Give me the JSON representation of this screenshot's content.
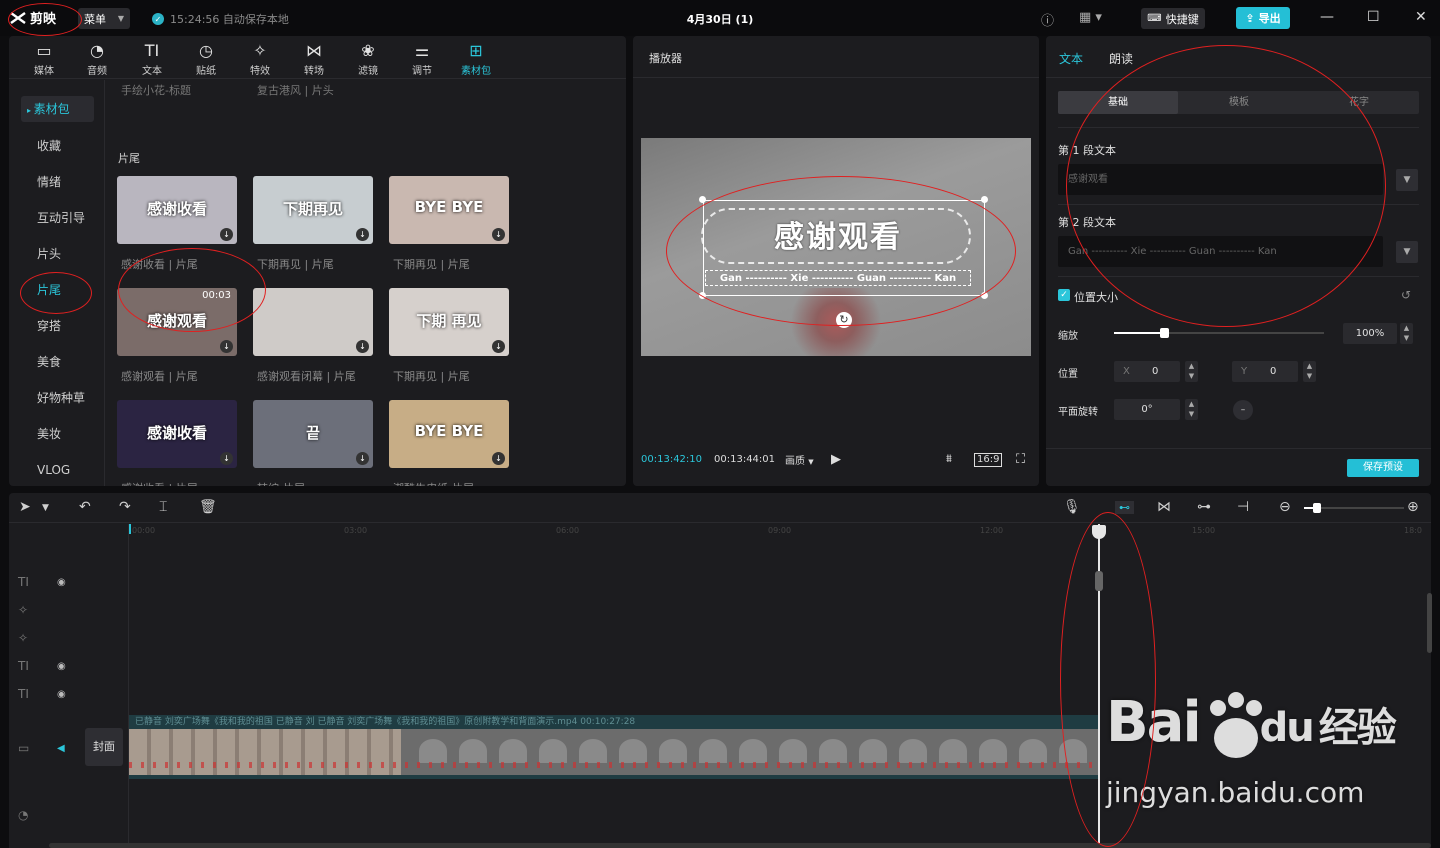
{
  "titlebar": {
    "app_name": "剪映",
    "menu_label": "菜单",
    "save_status": "15:24:56 自动保存本地",
    "doc_title": "4月30日 (1)",
    "shortcut_label": "快捷键",
    "export_label": "导出"
  },
  "media": {
    "toptabs": [
      {
        "icon": "▭",
        "label": "媒体"
      },
      {
        "icon": "◔",
        "label": "音频"
      },
      {
        "icon": "TI",
        "label": "文本"
      },
      {
        "icon": "◷",
        "label": "贴纸"
      },
      {
        "icon": "✧",
        "label": "特效"
      },
      {
        "icon": "⋈",
        "label": "转场"
      },
      {
        "icon": "❀",
        "label": "滤镜"
      },
      {
        "icon": "⚌",
        "label": "调节"
      },
      {
        "icon": "⊞",
        "label": "素材包"
      }
    ],
    "sidenav": [
      "素材包",
      "收藏",
      "情绪",
      "互动引导",
      "片头",
      "片尾",
      "穿搭",
      "美食",
      "好物种草",
      "美妆",
      "VLOG"
    ],
    "prev_labels": [
      "手绘小花-标题",
      "复古港风 | 片头"
    ],
    "section_label": "片尾",
    "items": [
      {
        "caption": "感谢收看 | 片尾",
        "thumb_text": "感谢收看",
        "bg": "#b9b6bf"
      },
      {
        "caption": "下期再见 | 片尾",
        "thumb_text": "下期再见",
        "bg": "#c7cdd0"
      },
      {
        "caption": "下期再见 | 片尾",
        "thumb_text": "BYE BYE",
        "bg": "#c9b8b0"
      },
      {
        "caption": "感谢观看 | 片尾",
        "thumb_text": "感谢观看",
        "bg": "#7b6c69",
        "duration": "00:03"
      },
      {
        "caption": "感谢观看闭幕 | 片尾",
        "thumb_text": "",
        "bg": "#cfcbc8"
      },
      {
        "caption": "下期再见 | 片尾",
        "thumb_text": "下期 再见",
        "bg": "#d6d0cc"
      },
      {
        "caption": "感谢收看 | 片尾",
        "thumb_text": "感谢收看",
        "bg": "#2b2442"
      },
      {
        "caption": "韩综-片尾",
        "thumb_text": "끝",
        "bg": "#6c6f7a"
      },
      {
        "caption": "潮酷牛皮纸-片尾",
        "thumb_text": "BYE BYE",
        "bg": "#c7ad86"
      }
    ]
  },
  "player": {
    "title": "播放器",
    "overlay_title": "感谢观看",
    "overlay_sub": "Gan ---------- Xie ---------- Guan ---------- Kan",
    "current_time": "00:13:42:10",
    "total_time": "00:13:44:01",
    "quality_label": "画质",
    "ratio_label": "16:9"
  },
  "props": {
    "tabs": [
      "文本",
      "朗读"
    ],
    "segments": [
      "基础",
      "模板",
      "花字"
    ],
    "para1_label": "第 1 段文本",
    "para1_value": "感谢观看",
    "para2_label": "第 2 段文本",
    "para2_value": "Gan ---------- Xie ---------- Guan ---------- Kan",
    "pos_size_label": "位置大小",
    "scale_label": "缩放",
    "scale_value": "100%",
    "scale_level": 0.24,
    "position_label": "位置",
    "x_label": "X",
    "x_value": "0",
    "y_label": "Y",
    "y_value": "0",
    "rotate_label": "平面旋转",
    "rotate_value": "0°",
    "save_preset": "保存预设"
  },
  "timeline": {
    "ticks": [
      "00:00",
      "03:00",
      "06:00",
      "09:00",
      "12:00",
      "15:00",
      "18:0"
    ],
    "clip_label": "已静音   刘奕广场舞《我和我的祖国   已静音   刘   已静音   刘奕广场舞《我和我的祖国》原创附教学和背面演示.mp4   00:10:27:28",
    "cover_label": "封面"
  },
  "watermark": {
    "brand": "Bai",
    "brand2": "du",
    "brand_cn": "经验",
    "url": "jingyan.baidu.com"
  }
}
